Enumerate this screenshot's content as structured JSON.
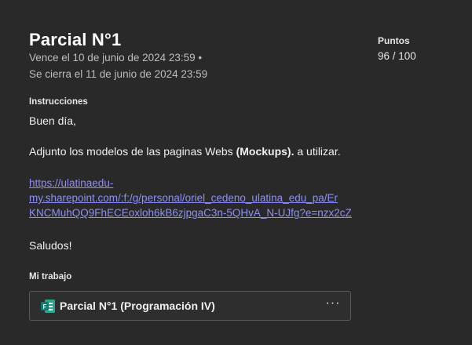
{
  "assignment": {
    "title": "Parcial N°1",
    "due": "Vence el 10 de junio de 2024 23:59 •",
    "closes": "Se cierra el 11 de junio de 2024 23:59"
  },
  "points": {
    "label": "Puntos",
    "value": "96 / 100"
  },
  "instructions": {
    "label": "Instrucciones",
    "greeting": "Buen día,",
    "attach_prefix": "Adjunto los modelos de las paginas Webs ",
    "attach_bold": "(Mockups).",
    "attach_suffix": " a utilizar.",
    "link_line1": "https://ulatinaedu-",
    "link_line2": "my.sharepoint.com/:f:/g/personal/oriel_cedeno_ulatina_edu_pa/Er",
    "link_line3": "KNCMuhQQ9FhECEoxloh6kB6zjpgaC3n-5QHvA_N-UJfg?e=nzx2cZ",
    "farewell": "Saludos!"
  },
  "my_work": {
    "label": "Mi trabajo",
    "file_name": "Parcial N°1 (Programación IV)",
    "more_label": "···",
    "file_icon": "forms-icon"
  },
  "colors": {
    "background": "#292929",
    "link": "#8f8ff5",
    "forms_icon": "#0f7b6c"
  }
}
